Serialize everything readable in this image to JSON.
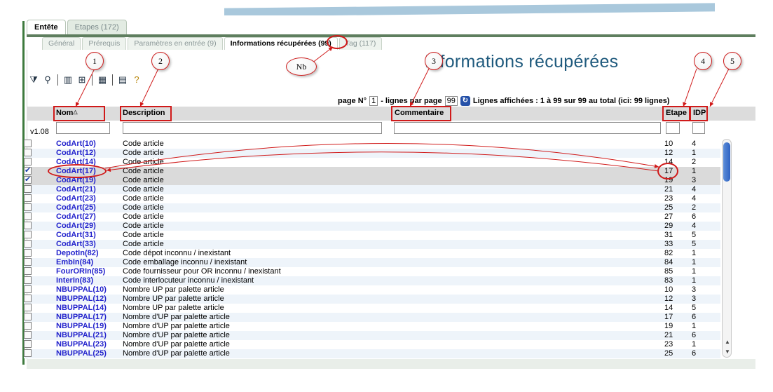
{
  "tabs_main": [
    {
      "label": "Entête",
      "active": true
    },
    {
      "label": "Etapes (172)",
      "active": false
    }
  ],
  "tabs_sub": [
    {
      "label": "Général",
      "active": false
    },
    {
      "label": "Prérequis",
      "active": false
    },
    {
      "label": "Paramètres en entrée (9)",
      "active": false
    },
    {
      "label": "Informations récupérées (99)",
      "active": true
    },
    {
      "label": "Tag (117)",
      "active": false
    }
  ],
  "page_title": "Informations récupérées",
  "toolbar_icons": [
    "filter-icon",
    "search-icon",
    "columns-icon",
    "tree-icon",
    "grid-icon",
    "export-icon",
    "help-icon"
  ],
  "pager": {
    "page_label": "page N°",
    "page_value": "1",
    "lines_label": "- lignes par page",
    "lines_value": "99",
    "summary": "Lignes affichées : 1 à 99 sur 99 au total (ici: 99 lignes)"
  },
  "columns": {
    "nom": "Nom",
    "description": "Description",
    "commentaire": "Commentaire",
    "etape": "Etape",
    "idp": "IDP"
  },
  "version": "v1.08",
  "rows": [
    {
      "nom": "CodArt(10)",
      "desc": "Code article",
      "etape": "10",
      "idp": "4",
      "checked": false
    },
    {
      "nom": "CodArt(12)",
      "desc": "Code article",
      "etape": "12",
      "idp": "1",
      "checked": false
    },
    {
      "nom": "CodArt(14)",
      "desc": "Code article",
      "etape": "14",
      "idp": "2",
      "checked": false
    },
    {
      "nom": "CodArt(17)",
      "desc": "Code article",
      "etape": "17",
      "idp": "1",
      "checked": true
    },
    {
      "nom": "CodArt(19)",
      "desc": "Code article",
      "etape": "19",
      "idp": "3",
      "checked": true
    },
    {
      "nom": "CodArt(21)",
      "desc": "Code article",
      "etape": "21",
      "idp": "4",
      "checked": false
    },
    {
      "nom": "CodArt(23)",
      "desc": "Code article",
      "etape": "23",
      "idp": "4",
      "checked": false
    },
    {
      "nom": "CodArt(25)",
      "desc": "Code article",
      "etape": "25",
      "idp": "2",
      "checked": false
    },
    {
      "nom": "CodArt(27)",
      "desc": "Code article",
      "etape": "27",
      "idp": "6",
      "checked": false
    },
    {
      "nom": "CodArt(29)",
      "desc": "Code article",
      "etape": "29",
      "idp": "4",
      "checked": false
    },
    {
      "nom": "CodArt(31)",
      "desc": "Code article",
      "etape": "31",
      "idp": "5",
      "checked": false
    },
    {
      "nom": "CodArt(33)",
      "desc": "Code article",
      "etape": "33",
      "idp": "5",
      "checked": false
    },
    {
      "nom": "DepotIn(82)",
      "desc": "Code dépot inconnu / inexistant",
      "etape": "82",
      "idp": "1",
      "checked": false
    },
    {
      "nom": "EmbIn(84)",
      "desc": "Code emballage inconnu / inexistant",
      "etape": "84",
      "idp": "1",
      "checked": false
    },
    {
      "nom": "FourORIn(85)",
      "desc": "Code fournisseur pour OR inconnu / inexistant",
      "etape": "85",
      "idp": "1",
      "checked": false
    },
    {
      "nom": "InterIn(83)",
      "desc": "Code interlocuteur inconnu / inexistant",
      "etape": "83",
      "idp": "1",
      "checked": false
    },
    {
      "nom": "NBUPPAL(10)",
      "desc": "Nombre UP par palette article",
      "etape": "10",
      "idp": "3",
      "checked": false
    },
    {
      "nom": "NBUPPAL(12)",
      "desc": "Nombre UP par palette article",
      "etape": "12",
      "idp": "3",
      "checked": false
    },
    {
      "nom": "NBUPPAL(14)",
      "desc": "Nombre UP par palette article",
      "etape": "14",
      "idp": "5",
      "checked": false
    },
    {
      "nom": "NBUPPAL(17)",
      "desc": "Nombre d'UP par palette article",
      "etape": "17",
      "idp": "6",
      "checked": false
    },
    {
      "nom": "NBUPPAL(19)",
      "desc": "Nombre d'UP par palette article",
      "etape": "19",
      "idp": "1",
      "checked": false
    },
    {
      "nom": "NBUPPAL(21)",
      "desc": "Nombre d'UP par palette article",
      "etape": "21",
      "idp": "6",
      "checked": false
    },
    {
      "nom": "NBUPPAL(23)",
      "desc": "Nombre d'UP par palette article",
      "etape": "23",
      "idp": "1",
      "checked": false
    },
    {
      "nom": "NBUPPAL(25)",
      "desc": "Nombre d'UP par palette article",
      "etape": "25",
      "idp": "6",
      "checked": false
    }
  ],
  "annotations": {
    "c1": "1",
    "c2": "2",
    "c3": "3",
    "c4": "4",
    "c5": "5",
    "nb": "Nb"
  },
  "colors": {
    "accent_green": "#5e7e5e",
    "title_blue": "#1f5a7d",
    "link_blue": "#2222cc",
    "annotation_red": "#d01a1a"
  }
}
